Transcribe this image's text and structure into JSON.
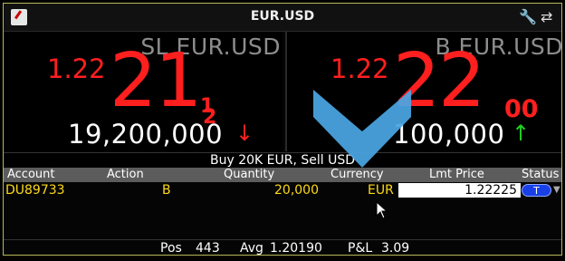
{
  "window": {
    "title": "EUR.USD"
  },
  "sell": {
    "label": "SL EUR.USD",
    "prefix": "1.22",
    "big_digits": "21",
    "fraction_num": "1",
    "fraction_den": "2",
    "size": "19,200,000",
    "arrow": "↓"
  },
  "buy": {
    "label": "B EUR.USD",
    "prefix": "1.22",
    "big_digits": "22",
    "pip": "00",
    "size": "100,000",
    "arrow": "↑"
  },
  "order_description": "Buy 20K EUR, Sell USD",
  "columns": {
    "account": "Account",
    "action": "Action",
    "quantity": "Quantity",
    "currency": "Currency",
    "lmt_price": "Lmt Price",
    "status": "Status"
  },
  "order": {
    "account": "DU89733",
    "action": "B",
    "quantity": "20,000",
    "currency": "EUR",
    "lmt_price": "1.22225",
    "status": "T"
  },
  "footer": {
    "pos_label": "Pos",
    "pos_value": "443",
    "avg_label": "Avg",
    "avg_value": "1.20190",
    "pnl_label": "P&L",
    "pnl_value": "3.09"
  },
  "colors": {
    "ask_red": "#ff1f1f",
    "order_yellow": "#ffd91a",
    "status_blue": "#1840e6",
    "chevron_blue": "#4aa6e3"
  },
  "icons": {
    "window_icon": "app-icon",
    "wrench": "wrench-icon",
    "swap": "swap-icon"
  }
}
